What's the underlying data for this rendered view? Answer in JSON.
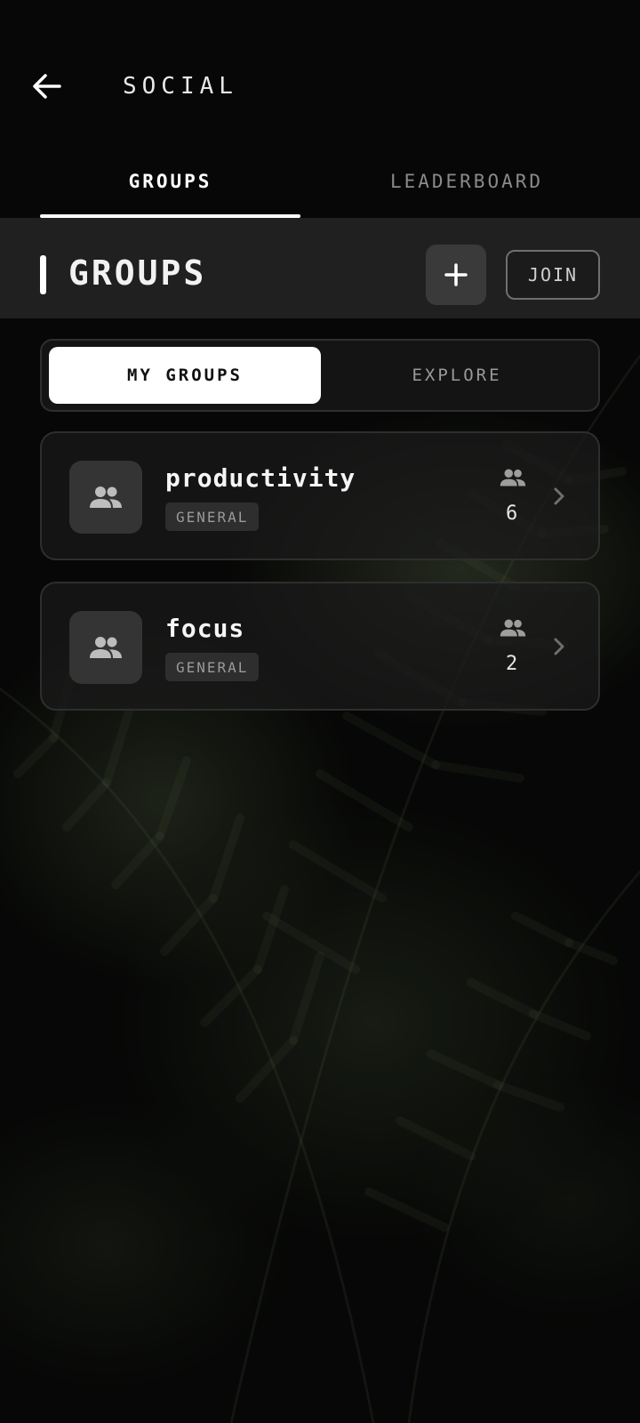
{
  "header": {
    "title": "SOCIAL"
  },
  "tabs": [
    {
      "label": "GROUPS",
      "active": true
    },
    {
      "label": "LEADERBOARD",
      "active": false
    }
  ],
  "section": {
    "title": "GROUPS",
    "add_label": "+",
    "join_label": "JOIN"
  },
  "segments": [
    {
      "label": "MY GROUPS",
      "active": true
    },
    {
      "label": "EXPLORE",
      "active": false
    }
  ],
  "groups": [
    {
      "name": "productivity",
      "tag": "GENERAL",
      "members": "6"
    },
    {
      "name": "focus",
      "tag": "GENERAL",
      "members": "2"
    }
  ],
  "icons": {
    "back": "arrow-left-icon",
    "add": "plus-icon",
    "group": "people-icon",
    "members": "people-icon",
    "chevron": "chevron-right-icon"
  },
  "colors": {
    "background": "#060706",
    "accent": "#ffffff",
    "card": "#1a1a1a",
    "muted_text": "#8a8a8a"
  }
}
